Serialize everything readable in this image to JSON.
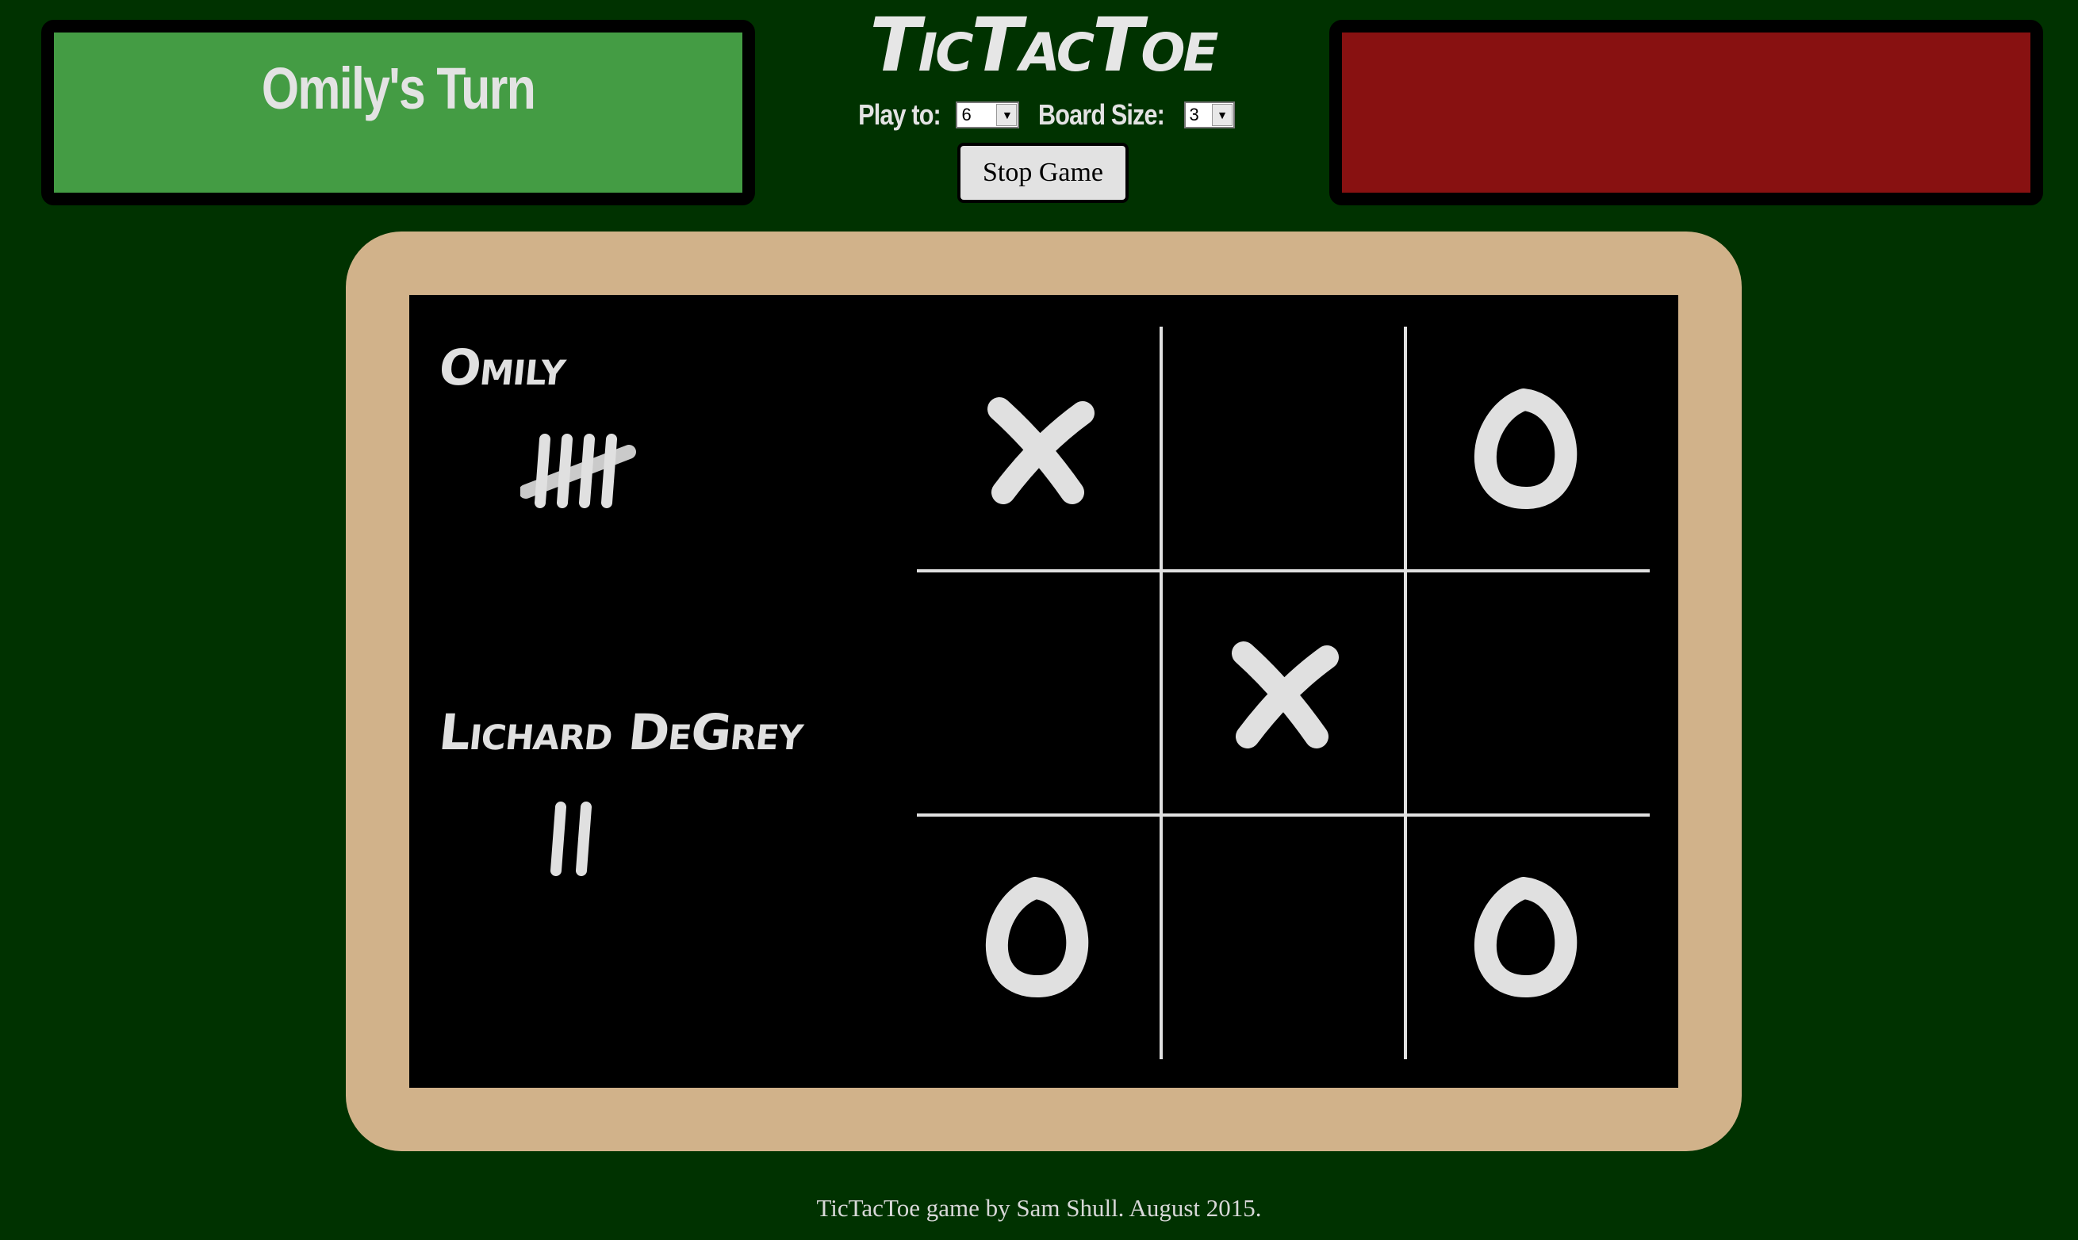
{
  "status": {
    "left_text": "Omily's Turn",
    "right_text": "",
    "left_color": "#449c44",
    "right_color": "#881111"
  },
  "title": "TicTacToe",
  "settings": {
    "play_to_label": "Play to:",
    "play_to_value": "6",
    "board_size_label": "Board Size:",
    "board_size_value": "3"
  },
  "stop_button_label": "Stop Game",
  "players": [
    {
      "name": "Omily",
      "wins": 5
    },
    {
      "name": "Lichard DeGrey",
      "wins": 2
    }
  ],
  "board": {
    "size": 3,
    "cells": [
      "X",
      "",
      "O",
      "",
      "X",
      "",
      "O",
      "",
      "O"
    ]
  },
  "colors": {
    "background": "#003200",
    "frame": "#d1b28a",
    "chalkboard": "#000000",
    "chalk": "#e0e0e0"
  },
  "footer": "TicTacToe game by Sam Shull. August 2015."
}
